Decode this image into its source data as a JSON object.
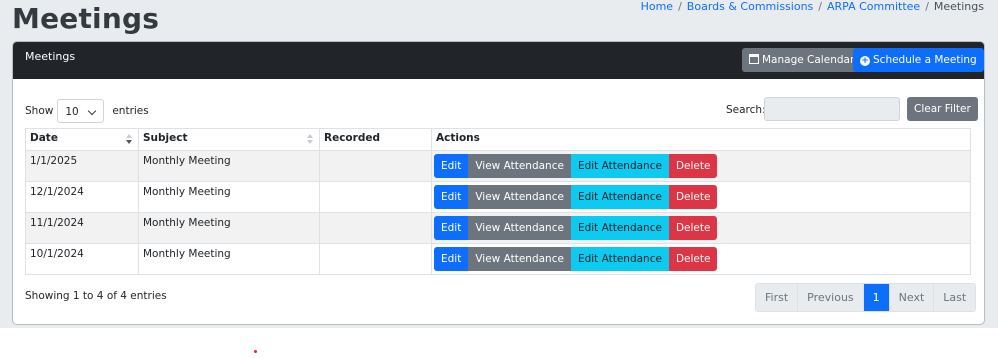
{
  "page": {
    "title": "Meetings"
  },
  "breadcrumb": {
    "items": [
      "Home",
      "Boards & Commissions",
      "ARPA Committee"
    ],
    "current": "Meetings"
  },
  "card": {
    "header_title": "Meetings",
    "manage_calendar_label": "Manage Calendar",
    "schedule_meeting_label": "Schedule a Meeting"
  },
  "controls": {
    "show_label": "Show",
    "entries_label": "entries",
    "page_length": "10",
    "search_label": "Search:",
    "search_value": "",
    "clear_filter_label": "Clear Filter"
  },
  "table": {
    "columns": [
      "Date",
      "Subject",
      "Recorded",
      "Actions"
    ],
    "rows": [
      {
        "date": "1/1/2025",
        "subject": "Monthly Meeting",
        "recorded": ""
      },
      {
        "date": "12/1/2024",
        "subject": "Monthly Meeting",
        "recorded": ""
      },
      {
        "date": "11/1/2024",
        "subject": "Monthly Meeting",
        "recorded": ""
      },
      {
        "date": "10/1/2024",
        "subject": "Monthly Meeting",
        "recorded": ""
      }
    ],
    "actions": {
      "edit": "Edit",
      "view_attendance": "View Attendance",
      "edit_attendance": "Edit Attendance",
      "delete": "Delete"
    }
  },
  "footer": {
    "info": "Showing 1 to 4 of 4 entries",
    "pager": {
      "first": "First",
      "previous": "Previous",
      "current": "1",
      "next": "Next",
      "last": "Last"
    }
  },
  "colors": {
    "header_bg": "#212529",
    "primary": "#0d6efd",
    "secondary": "#6c757d",
    "info": "#0dcaf0",
    "danger": "#dc3545"
  }
}
